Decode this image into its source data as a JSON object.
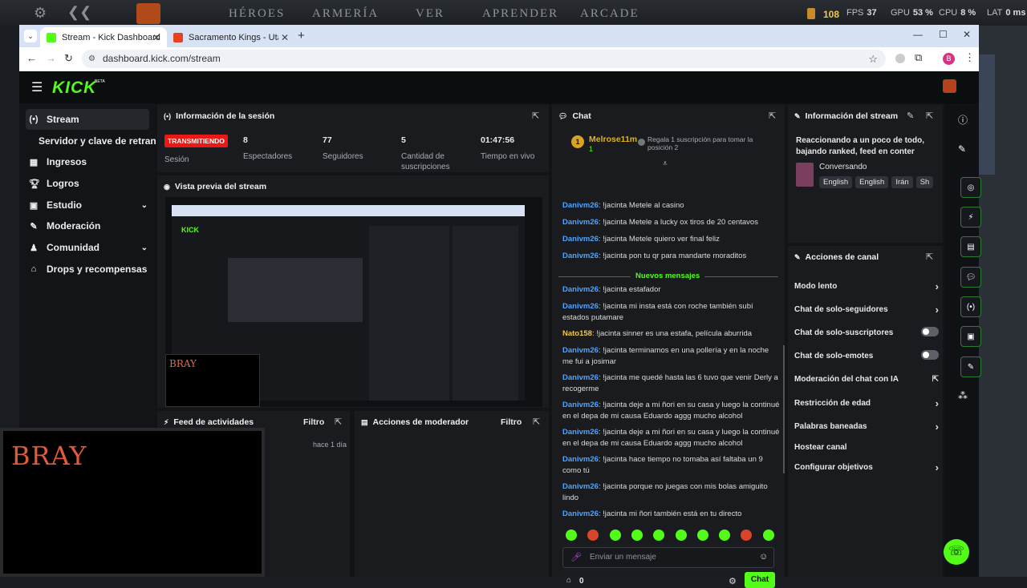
{
  "game_overlay": {
    "nav": [
      "HÉROES",
      "ARMERÍA",
      "VER",
      "APRENDER",
      "ARCADE"
    ],
    "gold": "108",
    "fps_label": "FPS",
    "fps": "37",
    "gpu_label": "GPU",
    "gpu": "53 %",
    "cpu_label": "CPU",
    "cpu": "8 %",
    "lat_label": "LAT",
    "lat": "0 ms"
  },
  "browser": {
    "tabs": [
      {
        "title": "Stream - Kick Dashboard",
        "favicon_color": "#53fc18"
      },
      {
        "title": "Sacramento Kings - Utah Jazz",
        "favicon_color": "#e8411d"
      }
    ],
    "url": "dashboard.kick.com/stream",
    "profile_initial": "B"
  },
  "kick": {
    "logo": "KICK",
    "beta": "BETA"
  },
  "sidebar": {
    "items": [
      {
        "label": "Stream",
        "icon": "broadcast-icon"
      },
      {
        "label": "Servidor y clave de retransmisión"
      },
      {
        "label": "Ingresos",
        "icon": "grid-icon"
      },
      {
        "label": "Logros",
        "icon": "trophy-icon"
      },
      {
        "label": "Estudio",
        "icon": "studio-icon"
      },
      {
        "label": "Moderación",
        "icon": "wrench-icon"
      },
      {
        "label": "Comunidad",
        "icon": "community-icon"
      },
      {
        "label": "Drops y recompensas",
        "icon": "gift-icon"
      }
    ]
  },
  "session": {
    "title": "Información de la sesión",
    "status": "TRANSMITIENDO",
    "status_label": "Sesión",
    "viewers": "8",
    "viewers_label": "Espectadores",
    "followers": "77",
    "followers_label": "Seguidores",
    "subs": "5",
    "subs_label": "Cantidad de suscripciones",
    "uptime": "01:47:56",
    "uptime_label": "Tiempo en vivo"
  },
  "preview": {
    "title": "Vista previa del stream",
    "overlay_text": "BRAY"
  },
  "activity": {
    "title": "Feed de actividades",
    "filter": "Filtro",
    "time": "hace 1 día"
  },
  "mod_actions": {
    "title": "Acciones de moderador",
    "filter": "Filtro"
  },
  "chat": {
    "title": "Chat",
    "pinned_user": "Melrose11m",
    "pinned_rank": "1",
    "pinned_count": "1",
    "gift_text": "Regala 1 suscripción para tomar la posición 2",
    "new_messages": "Nuevos mensajes",
    "messages": [
      {
        "user": "Danivm26",
        "text": "!jacinta Metele al casino"
      },
      {
        "user": "Danivm26",
        "text": "!jacinta Metele a lucky ox tiros de 20 centavos"
      },
      {
        "user": "Danivm26",
        "text": "!jacinta Metele quiero ver final feliz"
      },
      {
        "user": "Danivm26",
        "text": "!jacinta pon tu qr para mandarte moraditos"
      },
      {
        "user": "Danivm26",
        "text": "!jacinta estafador"
      },
      {
        "user": "Danivm26",
        "text": "!jacinta mi insta está con roche también subí estados putamare"
      },
      {
        "user": "Nato158",
        "text": "!jacinta sinner es una estafa, película aburrida"
      },
      {
        "user": "Danivm26",
        "text": "!jacinta terminamos en una pollería y en la noche me fui a josimar"
      },
      {
        "user": "Danivm26",
        "text": "!jacinta me quedé hasta las 6 tuvo que venir Derly a recogerme"
      },
      {
        "user": "Danivm26",
        "text": "!jacinta deje a mi ñori en su casa y luego la continué en el depa de mi causa Eduardo aggg mucho alcohol"
      },
      {
        "user": "Danivm26",
        "text": "!jacinta deje a mi ñori en su casa y luego la continué en el depa de mi causa Eduardo aggg mucho alcohol"
      },
      {
        "user": "Danivm26",
        "text": "!jacinta hace tiempo no tomaba así faltaba un 9 como tú"
      },
      {
        "user": "Danivm26",
        "text": "!jacinta porque no juegas con mis bolas amiguito lindo"
      },
      {
        "user": "Danivm26",
        "text": "!jacinta mi ñori también está en tu directo"
      }
    ],
    "input_placeholder": "Enviar un mensaje",
    "points": "0",
    "send": "Chat"
  },
  "stream_info": {
    "title": "Información del stream",
    "stream_title": "Reaccionando a un poco de todo, bajando ranked, feed en conter",
    "category": "Conversando",
    "tags": [
      "English",
      "English",
      "Irán",
      "Sh"
    ]
  },
  "channel_actions": {
    "title": "Acciones de canal",
    "items": [
      {
        "label": "Modo lento",
        "control": "arrow"
      },
      {
        "label": "Chat de solo-seguidores",
        "control": "arrow"
      },
      {
        "label": "Chat de solo-suscriptores",
        "control": "toggle"
      },
      {
        "label": "Chat de solo-emotes",
        "control": "toggle"
      },
      {
        "label": "Moderación del chat con IA",
        "control": "external"
      },
      {
        "label": "Restricción de edad",
        "control": "arrow"
      },
      {
        "label": "Palabras baneadas",
        "control": "arrow"
      },
      {
        "label": "Hostear canal",
        "control": "none"
      },
      {
        "label": "Configurar objetivos",
        "control": "arrow"
      }
    ]
  },
  "colors": {
    "kick_green": "#53fc18",
    "live_red": "#e91916",
    "username_blue": "#4fa4ff"
  }
}
